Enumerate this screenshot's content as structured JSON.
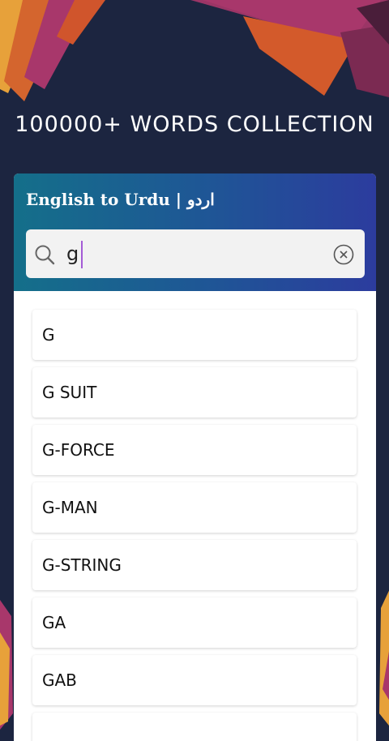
{
  "promo": {
    "title": "100000+ WORDS COLLECTION",
    "background_color": "#1c2540"
  },
  "app": {
    "title": "English to Urdu | اردو",
    "header_gradient": [
      "#146f8a",
      "#1f5596",
      "#2c3c9e"
    ],
    "search": {
      "value": "g",
      "icon": "search-icon",
      "clear_icon": "clear-circle-icon"
    },
    "results": [
      {
        "word": "G"
      },
      {
        "word": "G SUIT"
      },
      {
        "word": "G-FORCE"
      },
      {
        "word": "G-MAN"
      },
      {
        "word": "G-STRING"
      },
      {
        "word": "GA"
      },
      {
        "word": "GAB"
      }
    ]
  }
}
